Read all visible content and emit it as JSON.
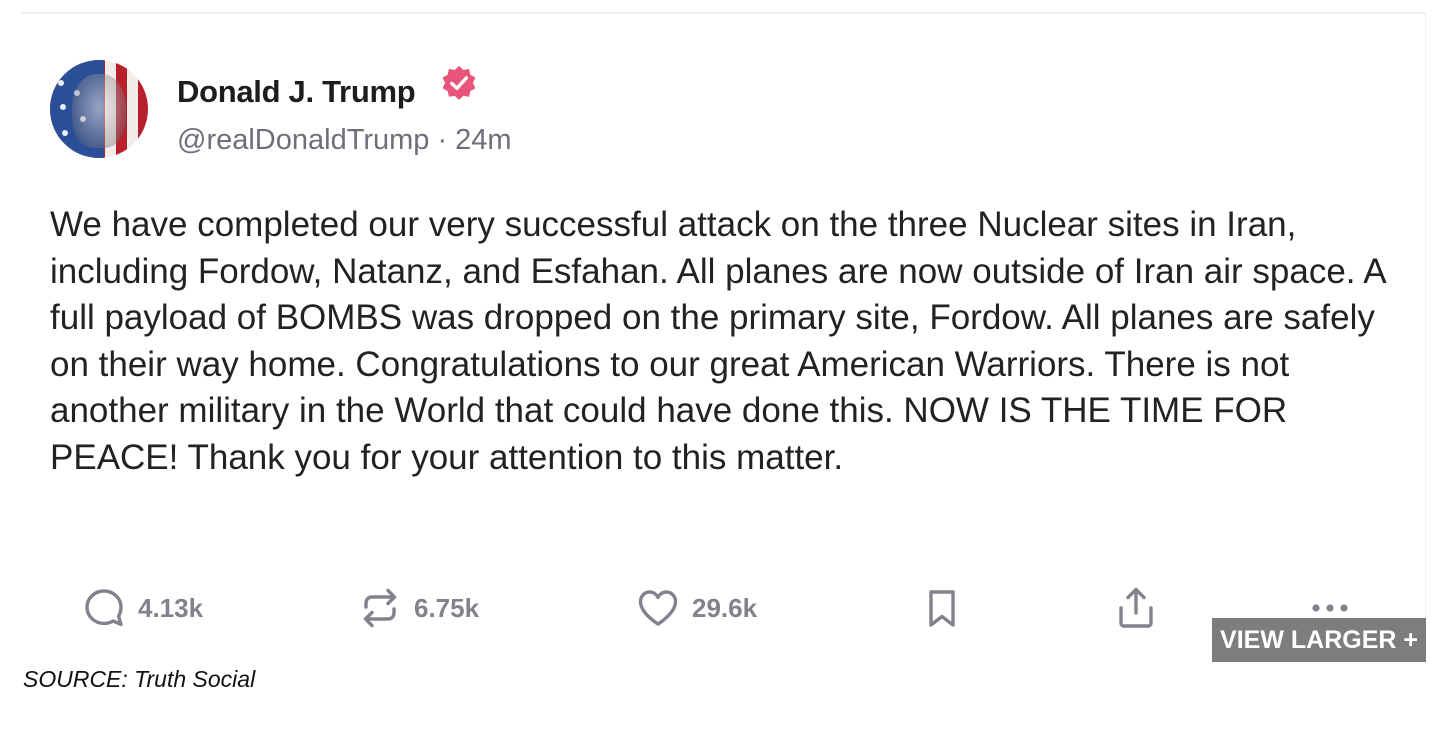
{
  "post": {
    "author_name": "Donald J. Trump",
    "handle_and_time": "@realDonaldTrump · 24m",
    "text": "We have completed our very successful attack on the three Nuclear sites in Iran, including Fordow, Natanz, and Esfahan. All planes are now outside of Iran air space. A full payload of BOMBS was dropped on the primary site, Fordow. All planes are safely on their way home. Congratulations to our great American Warriors. There is not another military in the World that could have done this. NOW IS THE TIME FOR PEACE! Thank you for your attention to this matter.",
    "verified_badge_color": "#e8547a"
  },
  "actions": {
    "replies": {
      "icon": "reply-icon",
      "count": "4.13k"
    },
    "reposts": {
      "icon": "repost-icon",
      "count": "6.75k"
    },
    "likes": {
      "icon": "heart-icon",
      "count": "29.6k"
    },
    "bookmark": {
      "icon": "bookmark-icon"
    },
    "share": {
      "icon": "share-icon"
    },
    "more": {
      "icon": "more-icon"
    }
  },
  "view_larger_label": "VIEW LARGER +",
  "source_caption": "SOURCE: Truth Social",
  "colors": {
    "text": "#222226",
    "muted": "#6f6f7a",
    "icon": "#82828d",
    "button_bg": "#7d7d7d"
  }
}
